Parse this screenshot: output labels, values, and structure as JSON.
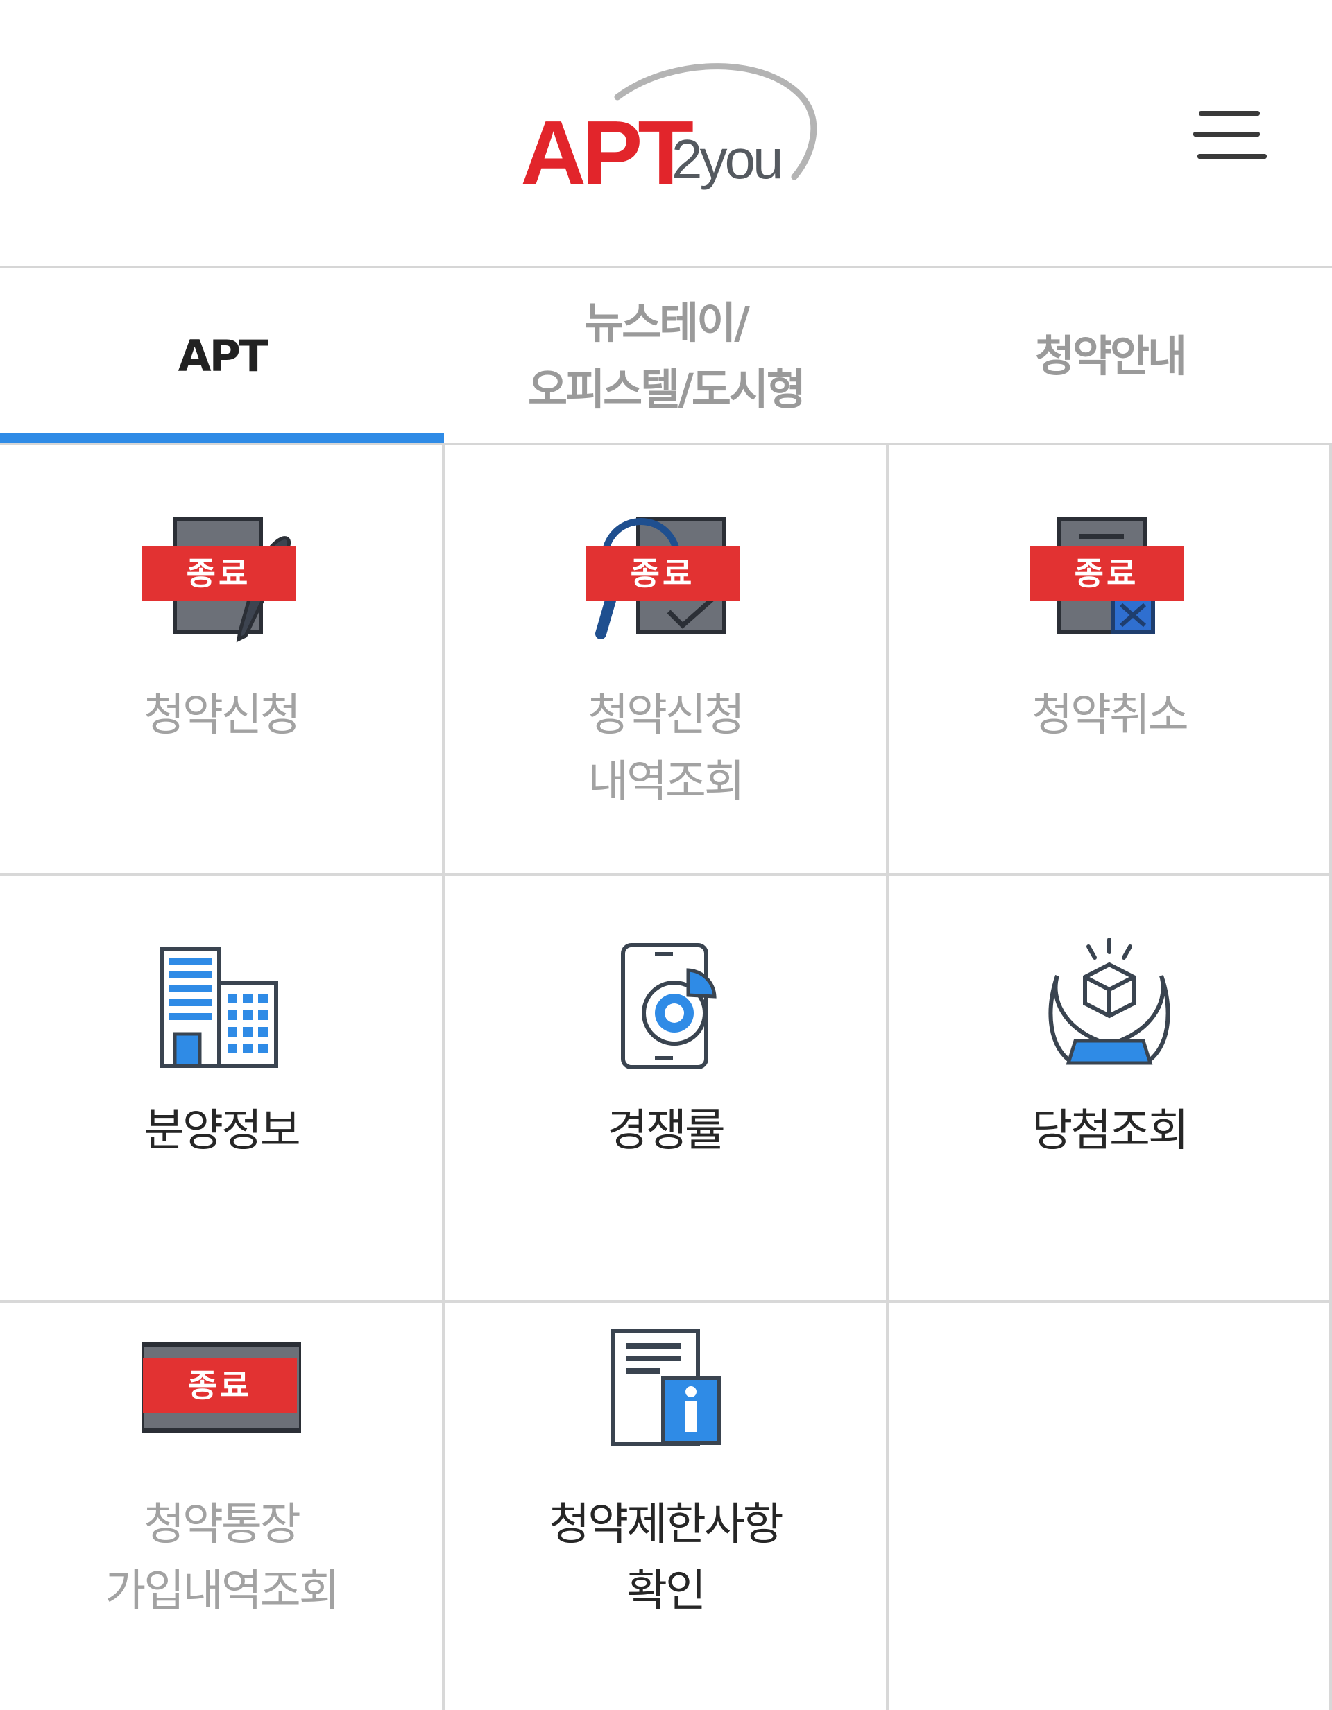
{
  "header": {
    "logo_main": "APT",
    "logo_sub": "2you",
    "menu_icon": "hamburger-menu-icon"
  },
  "tabs": [
    {
      "label": "APT",
      "active": true
    },
    {
      "label": "뉴스테이/\n오피스텔/도시형",
      "active": false
    },
    {
      "label": "청약안내",
      "active": false
    }
  ],
  "colors": {
    "brand_red": "#e2252b",
    "badge_red": "#e23232",
    "tab_indicator": "#2f8be6",
    "icon_blue": "#2f8be6",
    "icon_dark": "#3a4450"
  },
  "menu": {
    "items": [
      {
        "label": "청약신청",
        "badge": "종료",
        "icon": "document-pen-icon",
        "disabled": true
      },
      {
        "label": "청약신청\n내역조회",
        "badge": "종료",
        "icon": "document-search-icon",
        "disabled": true
      },
      {
        "label": "청약취소",
        "badge": "종료",
        "icon": "document-cancel-icon",
        "disabled": true
      },
      {
        "label": "분양정보",
        "badge": "",
        "icon": "buildings-icon",
        "disabled": false
      },
      {
        "label": "경쟁률",
        "badge": "",
        "icon": "tablet-pie-chart-icon",
        "disabled": false
      },
      {
        "label": "당첨조회",
        "badge": "",
        "icon": "hands-box-icon",
        "disabled": false
      },
      {
        "label": "청약통장\n가입내역조회",
        "badge": "종료",
        "icon": "bankbook-icon",
        "disabled": true
      },
      {
        "label": "청약제한사항\n확인",
        "badge": "",
        "icon": "document-info-icon",
        "disabled": false
      }
    ]
  }
}
